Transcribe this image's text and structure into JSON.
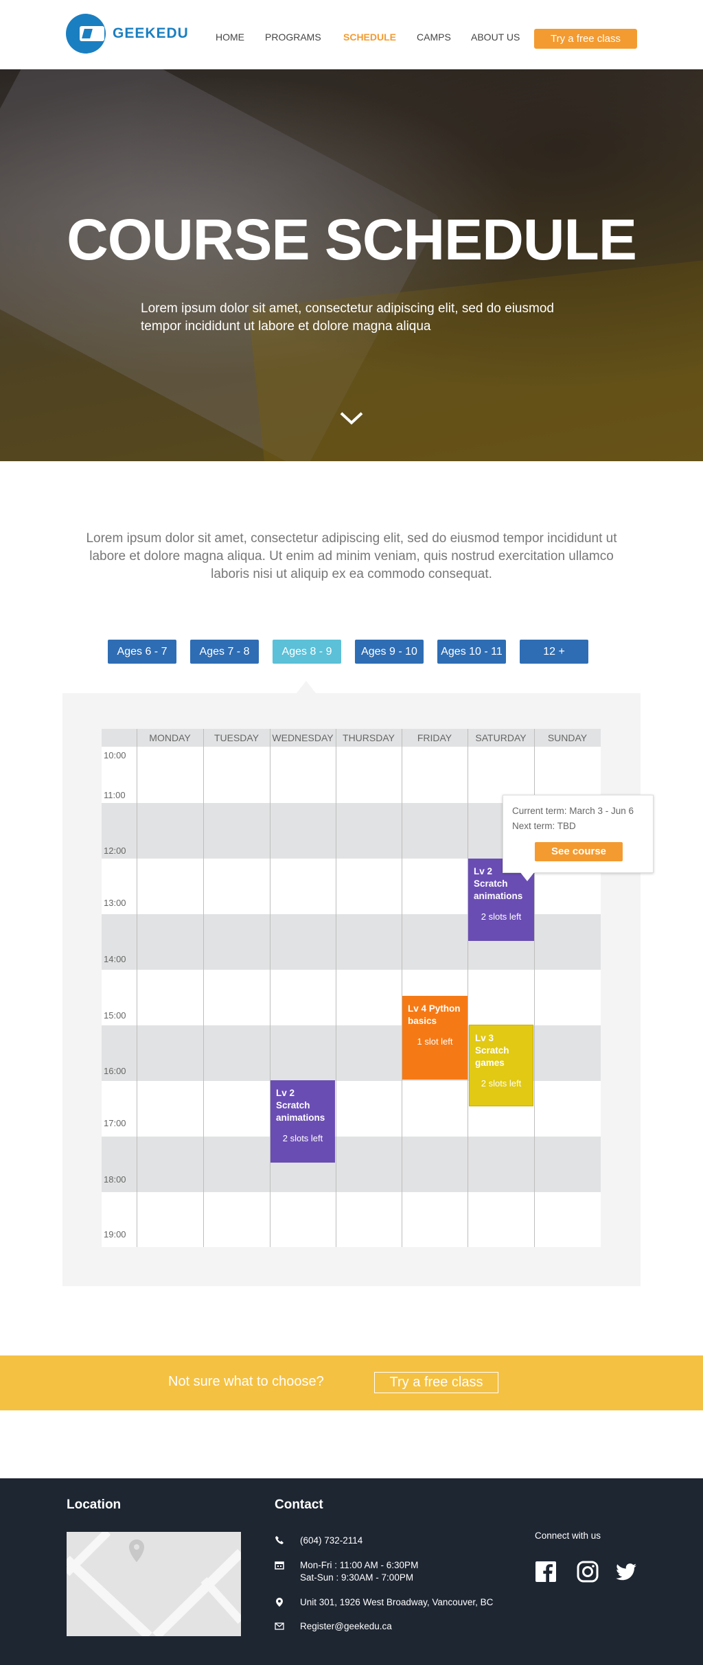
{
  "header": {
    "brand": "GEEKEDU",
    "nav": [
      {
        "label": "HOME",
        "active": false
      },
      {
        "label": "PROGRAMS",
        "active": false
      },
      {
        "label": "SCHEDULE",
        "active": true
      },
      {
        "label": "CAMPS",
        "active": false
      },
      {
        "label": "ABOUT US",
        "active": false
      }
    ],
    "cta_label": "Try a free class"
  },
  "hero": {
    "title": "COURSE SCHEDULE",
    "subtitle": "Lorem ipsum dolor sit amet, consectetur adipiscing elit, sed do eiusmod tempor incididunt ut labore et dolore magna aliqua"
  },
  "intro": "Lorem ipsum dolor sit amet, consectetur adipiscing elit, sed do eiusmod tempor incididunt ut labore et dolore magna aliqua. Ut enim ad minim veniam, quis nostrud exercitation ullamco laboris nisi ut aliquip ex ea commodo consequat.",
  "age_tabs": [
    {
      "label": "Ages 6 - 7",
      "active": false
    },
    {
      "label": "Ages 7 - 8",
      "active": false
    },
    {
      "label": "Ages 8 - 9",
      "active": true
    },
    {
      "label": "Ages 9 - 10",
      "active": false
    },
    {
      "label": "Ages 10 - 11",
      "active": false
    },
    {
      "label": "12 +",
      "active": false
    }
  ],
  "schedule": {
    "days": [
      "MONDAY",
      "TUESDAY",
      "WEDNESDAY",
      "THURSDAY",
      "FRIDAY",
      "SATURDAY",
      "SUNDAY"
    ],
    "times": [
      "10:00",
      "11:00",
      "12:00",
      "13:00",
      "14:00",
      "15:00",
      "16:00",
      "17:00",
      "18:00",
      "19:00"
    ],
    "events": [
      {
        "name": "Lv 2 Scratch animations",
        "slots": "2 slots left",
        "day": "SATURDAY",
        "start": "12:00",
        "end": "13:30",
        "color": "#6a4db3"
      },
      {
        "name": "Lv 4 Python basics",
        "slots": "1 slot left",
        "day": "FRIDAY",
        "start": "14:30",
        "end": "16:00",
        "color": "#f57a16"
      },
      {
        "name": "Lv 3 Scratch games",
        "slots": "2 slots left",
        "day": "SATURDAY",
        "start": "15:00",
        "end": "16:30",
        "color": "#e1c914"
      },
      {
        "name": "Lv 2 Scratch animations",
        "slots": "2 slots left",
        "day": "WEDNESDAY",
        "start": "16:00",
        "end": "17:30",
        "color": "#6a4db3"
      }
    ],
    "popup": {
      "current_term": "Current term: March 3 - Jun 6",
      "next_term": "Next term: TBD",
      "button": "See course"
    }
  },
  "cta_banner": {
    "text": "Not sure what to choose?",
    "button": "Try a free class"
  },
  "footer": {
    "location_title": "Location",
    "contact_title": "Contact",
    "phone": "(604) 732-2114",
    "hours_line1": "Mon-Fri : 11:00 AM - 6:30PM",
    "hours_line2": "Sat-Sun : 9:30AM - 7:00PM",
    "address": "Unit 301, 1926 West Broadway, Vancouver, BC",
    "email": "Register@geekedu.ca",
    "connect": "Connect with us",
    "social": [
      "facebook-icon",
      "instagram-icon",
      "twitter-icon"
    ]
  },
  "colors": {
    "brand_blue": "#1a7fc1",
    "accent_orange": "#f39b31",
    "tab_blue": "#2e6db4",
    "tab_active": "#5bc0d8",
    "banner_yellow": "#f5c142",
    "footer_bg": "#1e2632"
  }
}
